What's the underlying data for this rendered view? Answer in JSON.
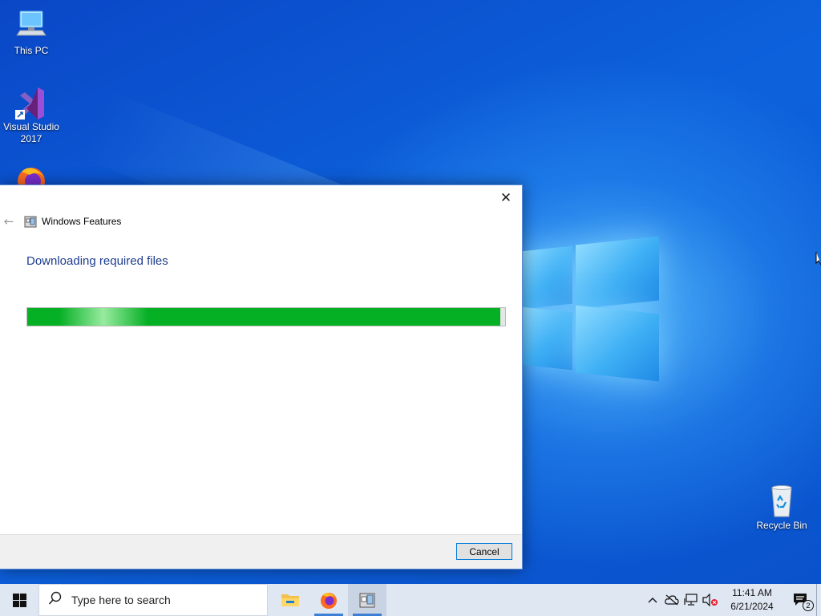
{
  "desktop": {
    "icons": [
      {
        "label": "This PC",
        "icon": "computer-icon"
      },
      {
        "label": "Visual Studio 2017",
        "icon": "visual-studio-icon"
      },
      {
        "label": "",
        "icon": "firefox-icon"
      },
      {
        "label": "Recycle Bin",
        "icon": "recycle-bin-icon"
      }
    ]
  },
  "dialog": {
    "title": "Windows Features",
    "heading": "Downloading required files",
    "progress": 0.99,
    "cancel_label": "Cancel",
    "close_glyph": "✕",
    "back_glyph": "←",
    "accent_color": "#06b025"
  },
  "taskbar": {
    "search_placeholder": "Type here to search",
    "apps": [
      {
        "name": "file-explorer",
        "icon": "folder-icon"
      },
      {
        "name": "firefox",
        "icon": "firefox-icon"
      },
      {
        "name": "windows-features",
        "icon": "windows-features-icon"
      }
    ],
    "clock_time": "11:41 AM",
    "clock_date": "6/21/2024",
    "notification_count": "2"
  }
}
